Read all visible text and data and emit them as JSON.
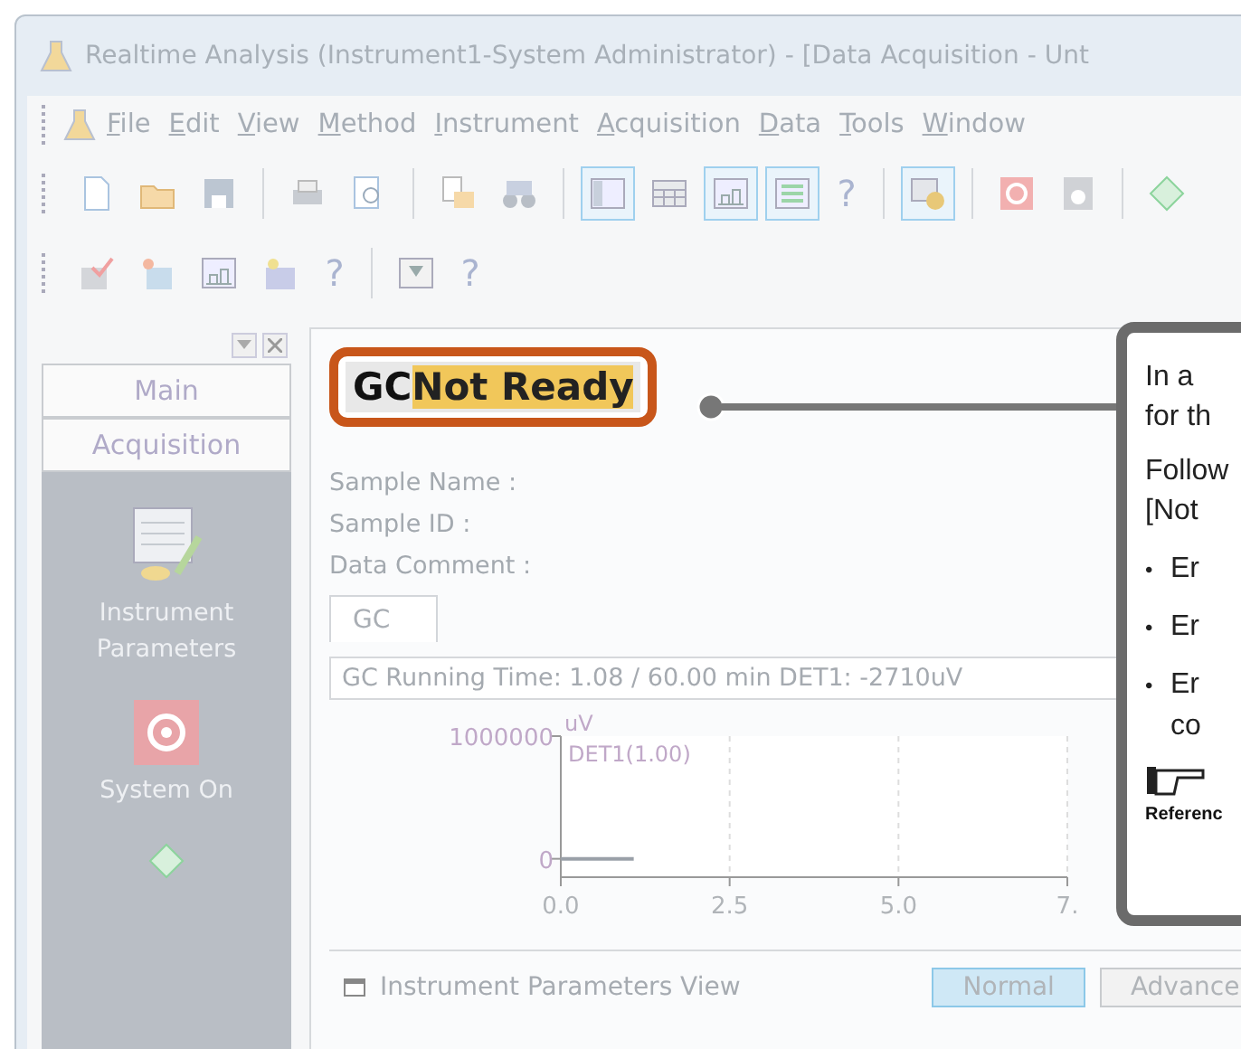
{
  "window": {
    "title": "Realtime Analysis (Instrument1-System Administrator) - [Data Acquisition - Unt"
  },
  "menu": [
    "File",
    "Edit",
    "View",
    "Method",
    "Instrument",
    "Acquisition",
    "Data",
    "Tools",
    "Window"
  ],
  "toolbar_1": [
    {
      "kind": "new",
      "pressed": false
    },
    {
      "kind": "open",
      "pressed": false
    },
    {
      "kind": "save",
      "pressed": false
    },
    {
      "kind": "sep"
    },
    {
      "kind": "print",
      "pressed": false
    },
    {
      "kind": "preview",
      "pressed": false
    },
    {
      "kind": "sep"
    },
    {
      "kind": "copy",
      "pressed": false
    },
    {
      "kind": "find",
      "pressed": false
    },
    {
      "kind": "sep"
    },
    {
      "kind": "layout",
      "pressed": true
    },
    {
      "kind": "table",
      "pressed": false
    },
    {
      "kind": "chart",
      "pressed": true
    },
    {
      "kind": "list",
      "pressed": true
    },
    {
      "kind": "help",
      "label": "?"
    },
    {
      "kind": "sep"
    },
    {
      "kind": "settings",
      "pressed": true
    },
    {
      "kind": "sep"
    },
    {
      "kind": "record",
      "pressed": false
    },
    {
      "kind": "device",
      "pressed": false
    },
    {
      "kind": "sep"
    },
    {
      "kind": "start",
      "pressed": false
    }
  ],
  "toolbar_2": [
    {
      "kind": "check",
      "pressed": false
    },
    {
      "kind": "sun",
      "pressed": false
    },
    {
      "kind": "chart",
      "pressed": false
    },
    {
      "kind": "star",
      "pressed": false
    },
    {
      "kind": "help",
      "label": "?"
    },
    {
      "kind": "sep"
    },
    {
      "kind": "filter",
      "pressed": false
    },
    {
      "kind": "help",
      "label": "?"
    }
  ],
  "sidebar": {
    "sections": [
      "Main",
      "Acquisition"
    ],
    "items": [
      {
        "kind": "params",
        "label": "Instrument Parameters"
      },
      {
        "kind": "power",
        "label": "System On"
      },
      {
        "kind": "start"
      }
    ]
  },
  "status": {
    "instrument": "GC",
    "state": "Not Ready"
  },
  "fields": [
    "Sample Name :",
    "Sample ID :",
    "Data Comment :"
  ],
  "tabs": [
    {
      "label": "GC",
      "selected": true
    }
  ],
  "running_info": "GC Running Time: 1.08 / 60.00 min DET1: -2710uV",
  "chart_data": {
    "type": "line",
    "ylabel": "uV",
    "x": [
      0,
      1.08
    ],
    "series": [
      {
        "name": "DET1(1.00)",
        "color": "#9aa0a8",
        "values": [
          0,
          0
        ]
      }
    ],
    "xlim": [
      0,
      7.5
    ],
    "ylim": [
      -150000,
      1000000
    ],
    "xticks": [
      {
        "value": 0,
        "label": "0.0"
      },
      {
        "value": 2.5,
        "label": "2.5"
      },
      {
        "value": 5,
        "label": "5.0"
      },
      {
        "value": 7.5,
        "label": "7."
      }
    ],
    "yticks": [
      0,
      1000000
    ]
  },
  "bottom_panel": {
    "title": "Instrument Parameters View",
    "buttons": [
      {
        "label": "Normal",
        "selected": true
      },
      {
        "label": "Advance",
        "selected": false
      }
    ]
  },
  "callout": {
    "lines": [
      {
        "kind": "text",
        "text": "In a"
      },
      {
        "kind": "text",
        "text": "for th"
      },
      {
        "kind": "para",
        "text": "Follow"
      },
      {
        "kind": "text",
        "text": "[Not"
      },
      {
        "kind": "bullet",
        "bullet": "•",
        "text": "Er"
      },
      {
        "kind": "bullet",
        "bullet": "•",
        "text": "Er"
      },
      {
        "kind": "bullet",
        "bullet": "•",
        "text": "Er"
      },
      {
        "kind": "cont",
        "text": "co"
      },
      {
        "kind": "reference",
        "text": "Referenc"
      }
    ]
  }
}
